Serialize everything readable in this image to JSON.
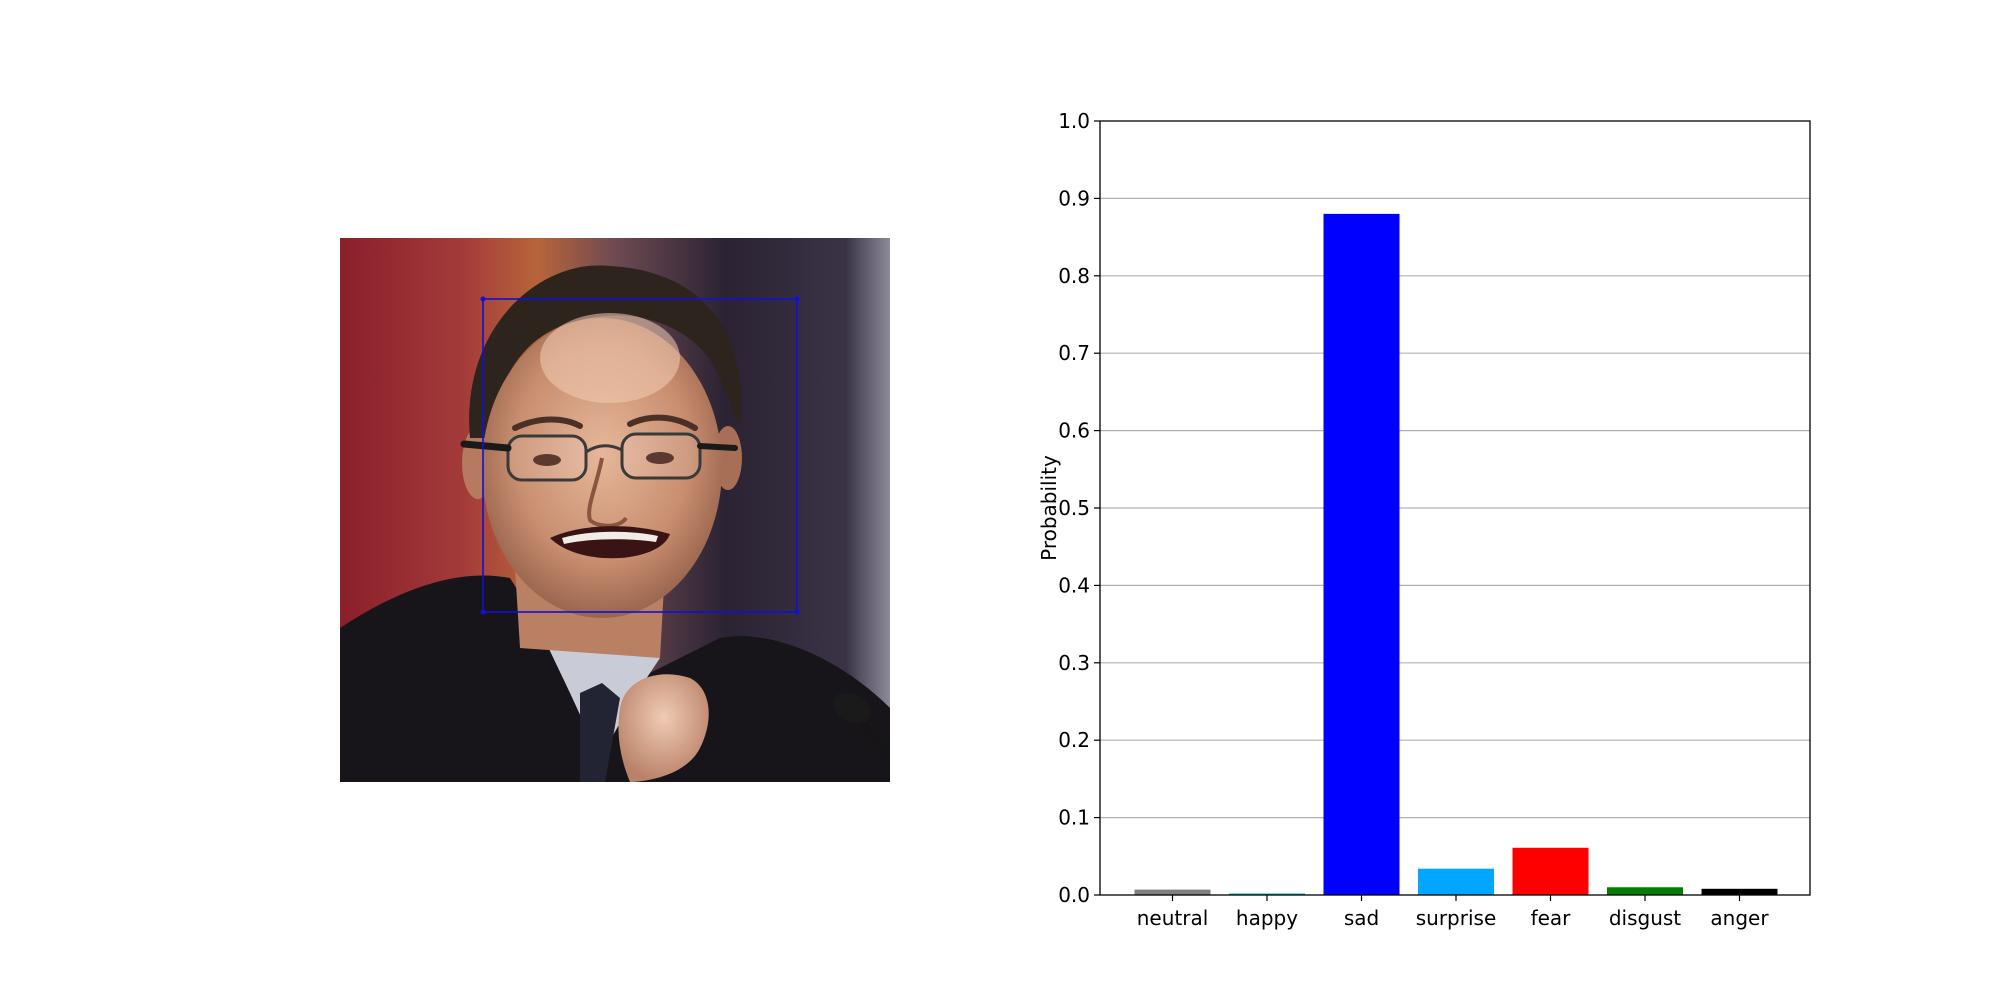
{
  "photo": {
    "face_box_color": "#1010d8"
  },
  "chart_data": {
    "type": "bar",
    "categories": [
      "neutral",
      "happy",
      "sad",
      "surprise",
      "fear",
      "disgust",
      "anger"
    ],
    "values": [
      0.007,
      0.002,
      0.88,
      0.034,
      0.061,
      0.01,
      0.008
    ],
    "colors": [
      "#808080",
      "#00bfbf",
      "#0000ff",
      "#00a6ff",
      "#ff0000",
      "#008000",
      "#000000"
    ],
    "title": "",
    "xlabel": "",
    "ylabel": "Probability",
    "ylim": [
      0,
      1.0
    ],
    "yticks": [
      "0.0",
      "0.1",
      "0.2",
      "0.3",
      "0.4",
      "0.5",
      "0.6",
      "0.7",
      "0.8",
      "0.9",
      "1.0"
    ],
    "grid": "y"
  }
}
